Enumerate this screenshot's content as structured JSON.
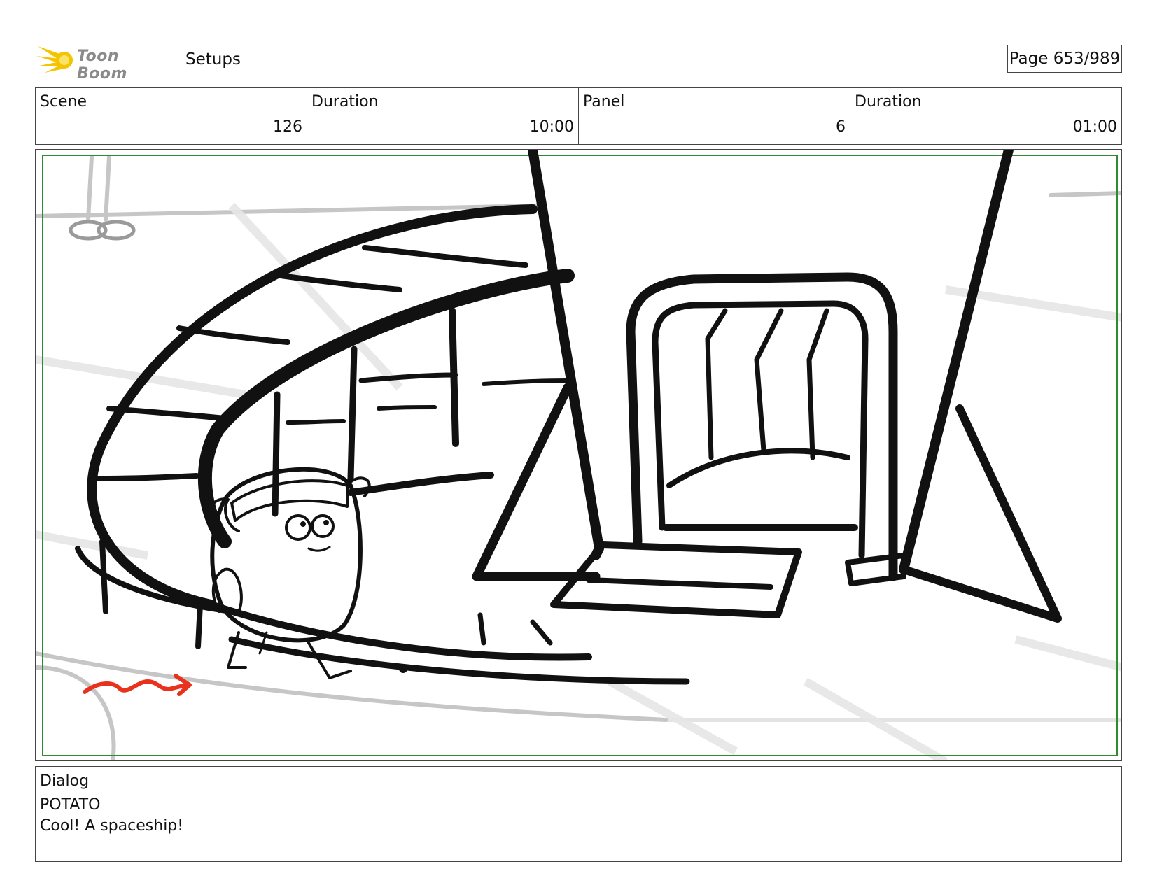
{
  "header": {
    "brand": "Toon Boom",
    "section": "Setups",
    "page": "Page 653/989"
  },
  "info": {
    "scene_label": "Scene",
    "scene_value": "126",
    "duration_label": "Duration",
    "duration_value": "10:00",
    "panel_label": "Panel",
    "panel_value": "6",
    "panel_duration_label": "Duration",
    "panel_duration_value": "01:00"
  },
  "panel_image": {
    "description_icon": "storyboard-sketch"
  },
  "dialog": {
    "label": "Dialog",
    "speaker": "POTATO",
    "line": "Cool! A spaceship!"
  },
  "colors": {
    "logo_yellow": "#f5c400",
    "safe_frame": "#2e8b2e",
    "motion_arrow": "#e8321e"
  }
}
